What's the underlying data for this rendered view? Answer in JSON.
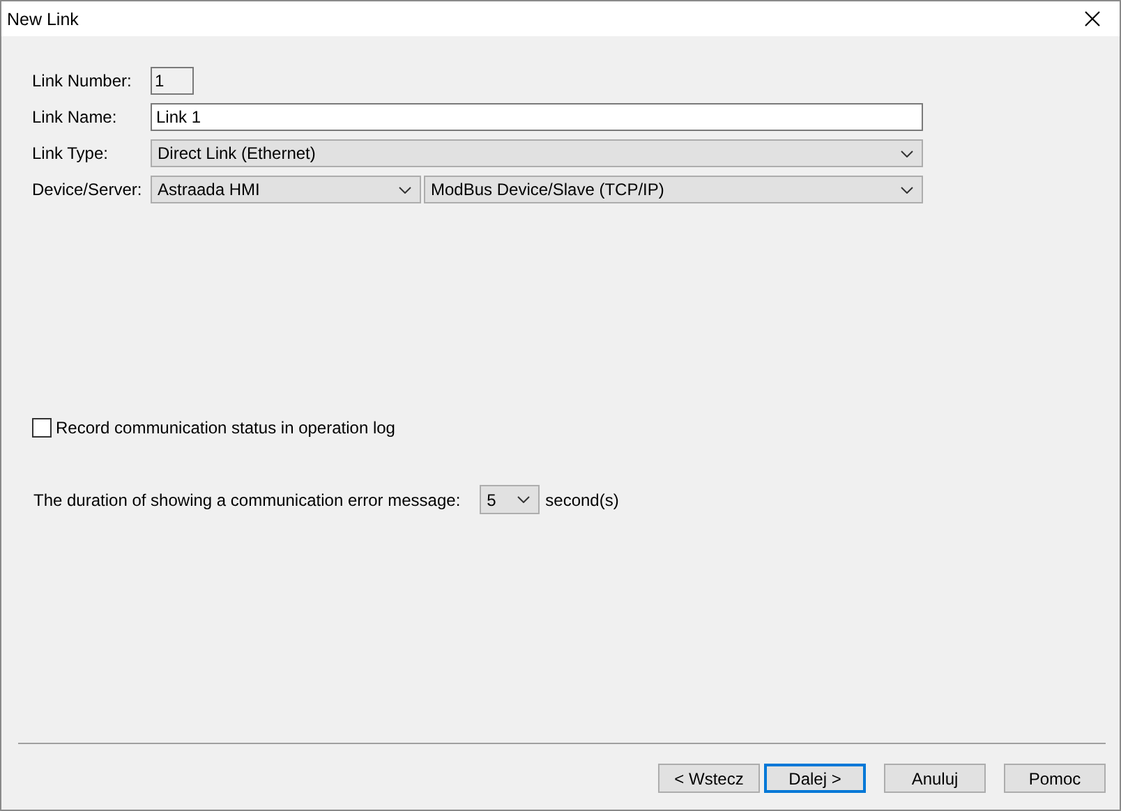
{
  "window": {
    "title": "New Link"
  },
  "link_number": {
    "label": "Link Number:",
    "value": "1"
  },
  "link_name": {
    "label": "Link Name:",
    "value": "Link 1"
  },
  "link_type": {
    "label": "Link Type:",
    "value": "Direct Link (Ethernet)"
  },
  "device_server": {
    "label": "Device/Server:",
    "device": "Astraada HMI",
    "driver": "ModBus Device/Slave (TCP/IP)"
  },
  "record_status": {
    "label": "Record communication status in operation log",
    "checked": false
  },
  "error_duration": {
    "label": "The duration of showing a communication error message:",
    "value": "5",
    "unit": "second(s)"
  },
  "buttons": [
    {
      "label": "< Wstecz",
      "focused": false
    },
    {
      "label": "Dalej >",
      "focused": true
    },
    {
      "label": "Anuluj",
      "focused": false
    },
    {
      "label": "Pomoc",
      "focused": false
    }
  ]
}
